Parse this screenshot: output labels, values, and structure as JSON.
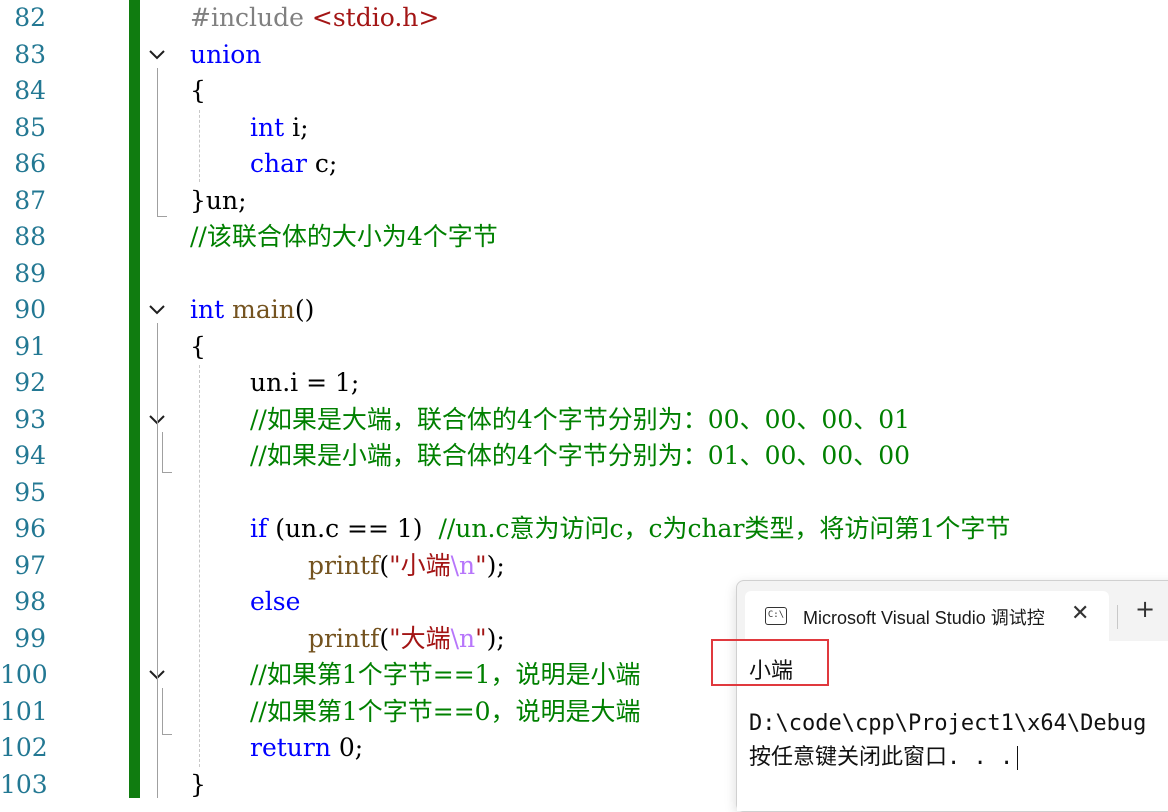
{
  "editor": {
    "lines": [
      {
        "num": "82"
      },
      {
        "num": "83"
      },
      {
        "num": "84"
      },
      {
        "num": "85"
      },
      {
        "num": "86"
      },
      {
        "num": "87"
      },
      {
        "num": "88"
      },
      {
        "num": "89"
      },
      {
        "num": "90"
      },
      {
        "num": "91"
      },
      {
        "num": "92"
      },
      {
        "num": "93"
      },
      {
        "num": "94"
      },
      {
        "num": "95"
      },
      {
        "num": "96"
      },
      {
        "num": "97"
      },
      {
        "num": "98"
      },
      {
        "num": "99"
      },
      {
        "num": "100"
      },
      {
        "num": "101"
      },
      {
        "num": "102"
      },
      {
        "num": "103"
      }
    ],
    "code": {
      "l82_pre": "#include",
      "l82_hdr": "<stdio.h>",
      "l83_kw": "union",
      "l84": "{",
      "l85_kw": "int",
      "l85_rest": " i;",
      "l86_kw": "char",
      "l86_rest": " c;",
      "l87": "}un;",
      "l88_cmt": "//该联合体的大小为4个字节",
      "l90_kw": "int",
      "l90_fn": "main",
      "l90_rest": "()",
      "l91": "{",
      "l92": "un.i = 1;",
      "l93_cmt": "//如果是大端，联合体的4个字节分别为：00、00、00、01",
      "l94_cmt": "//如果是小端，联合体的4个字节分别为：01、00、00、00",
      "l96_kw": "if",
      "l96_rest": " (un.c == 1)  ",
      "l96_cmt": "//un.c意为访问c，c为char类型，将访问第1个字节",
      "l97_fn": "printf",
      "l97_open": "(",
      "l97_str1": "\"小端",
      "l97_esc": "\\n",
      "l97_str2": "\"",
      "l97_close": ");",
      "l98_kw": "else",
      "l99_fn": "printf",
      "l99_open": "(",
      "l99_str1": "\"大端",
      "l99_esc": "\\n",
      "l99_str2": "\"",
      "l99_close": ");",
      "l100_cmt": "//如果第1个字节==1，说明是小端",
      "l101_cmt": "//如果第1个字节==0，说明是大端",
      "l102_kw": "return",
      "l102_rest": " 0;",
      "l103": "}"
    }
  },
  "console": {
    "tab_title": "Microsoft Visual Studio 调试控",
    "tab_icon_text": "C:\\",
    "close_glyph": "✕",
    "add_glyph": "+",
    "output_line1": "小端",
    "output_line2": "D:\\code\\cpp\\Project1\\x64\\Debug",
    "output_line3": "按任意键关闭此窗口. . ."
  },
  "colors": {
    "keyword": "#0000ff",
    "comment": "#008000",
    "string": "#a31515",
    "function": "#74531f",
    "escape": "#b776fb",
    "line_number": "#237893",
    "change_bar": "#107c10",
    "highlight_box": "#e0393e"
  }
}
